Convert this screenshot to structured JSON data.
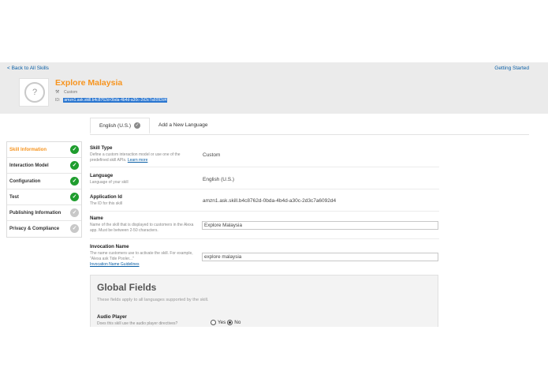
{
  "nav": {
    "back_label": "< Back to All Skills",
    "getting_started_label": "Getting Started"
  },
  "skill": {
    "icon_glyph": "?",
    "title": "Explore Malaysia",
    "type_label": "Custom",
    "id_prefix": "ID:",
    "id_value": "amzn1.ask.skill.b4c8762d-0bda-4b4d-a30c-2d3c7a6092d4"
  },
  "tabs": {
    "language_tab": "English (U.S.)",
    "add_language": "Add a New Language"
  },
  "sidebar": {
    "items": [
      {
        "label": "Skill Information",
        "status": "done",
        "active": true
      },
      {
        "label": "Interaction Model",
        "status": "done",
        "active": false
      },
      {
        "label": "Configuration",
        "status": "done",
        "active": false
      },
      {
        "label": "Test",
        "status": "done",
        "active": false
      },
      {
        "label": "Publishing Information",
        "status": "todo",
        "active": false
      },
      {
        "label": "Privacy & Compliance",
        "status": "todo",
        "active": false
      }
    ]
  },
  "form": {
    "skill_type": {
      "label": "Skill Type",
      "help": "Define a custom interaction model or use one of the predefined skill APIs.",
      "help_link": "Learn more",
      "value": "Custom"
    },
    "language": {
      "label": "Language",
      "help": "Language of your skill",
      "value": "English (U.S.)"
    },
    "application_id": {
      "label": "Application Id",
      "help": "The ID for this skill",
      "value": "amzn1.ask.skill.b4c8762d-0bda-4b4d-a30c-2d3c7a6092d4"
    },
    "name": {
      "label": "Name",
      "help": "Name of the skill that is displayed to customers in the Alexa app. Must be between 2-50 characters.",
      "value": "Explore Malaysia"
    },
    "invocation_name": {
      "label": "Invocation Name",
      "help": "The name customers use to activate the skill. For example, \"Alexa ask Tide Pooler...\"",
      "help_link": "Invocation Name Guidelines",
      "value": "explore malaysia"
    }
  },
  "global_fields": {
    "title": "Global Fields",
    "subtitle": "These fields apply to all languages supported by the skill.",
    "audio_player": {
      "label": "Audio Player",
      "help": "Does this skill use the audio player directives?",
      "yes_label": "Yes",
      "no_label": "No",
      "selected": "No"
    }
  },
  "colors": {
    "accent": "#f7941e",
    "link": "#0b5fa5",
    "success": "#1f9d2e",
    "selection": "#2a76d0"
  }
}
